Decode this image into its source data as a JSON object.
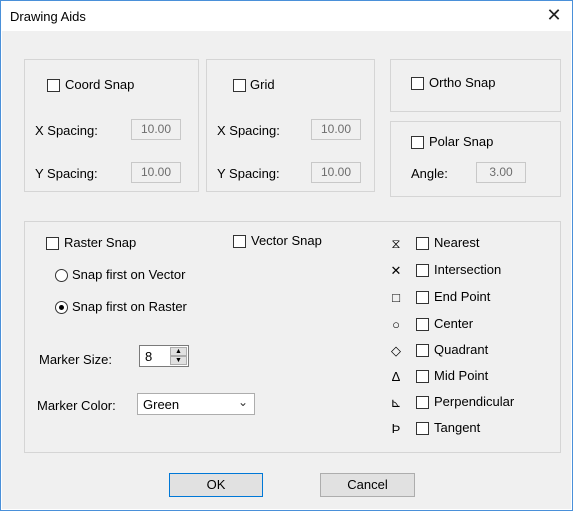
{
  "window": {
    "title": "Drawing Aids",
    "close_glyph": "✕"
  },
  "coord": {
    "label": "Coord Snap",
    "x_label": "X Spacing:",
    "x_value": "10.00",
    "y_label": "Y Spacing:",
    "y_value": "10.00"
  },
  "grid": {
    "label": "Grid",
    "x_label": "X Spacing:",
    "x_value": "10.00",
    "y_label": "Y Spacing:",
    "y_value": "10.00"
  },
  "ortho": {
    "label": "Ortho Snap"
  },
  "polar": {
    "label": "Polar Snap",
    "angle_label": "Angle:",
    "angle_value": "3.00"
  },
  "raster": {
    "label": "Raster Snap",
    "vector_label": "Vector Snap",
    "radio_vector": "Snap first on Vector",
    "radio_raster": "Snap first on Raster",
    "marker_size_label": "Marker Size:",
    "marker_size_value": "8",
    "marker_color_label": "Marker Color:",
    "marker_color_value": "Green"
  },
  "osnap": [
    {
      "glyph": "⧖",
      "label": "Nearest"
    },
    {
      "glyph": "✕",
      "label": "Intersection"
    },
    {
      "glyph": "□",
      "label": "End Point"
    },
    {
      "glyph": "○",
      "label": "Center"
    },
    {
      "glyph": "◇",
      "label": "Quadrant"
    },
    {
      "glyph": "Δ",
      "label": "Mid Point"
    },
    {
      "glyph": "⊾",
      "label": "Perpendicular"
    },
    {
      "glyph": "Ϸ",
      "label": "Tangent"
    }
  ],
  "buttons": {
    "ok": "OK",
    "cancel": "Cancel"
  }
}
